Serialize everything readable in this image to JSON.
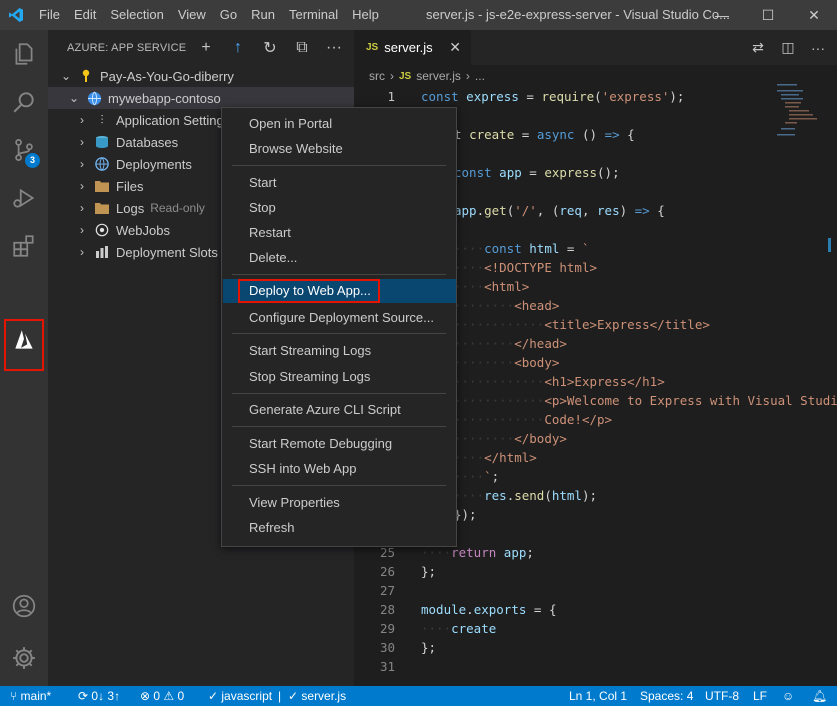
{
  "titlebar": {
    "menu": [
      "File",
      "Edit",
      "Selection",
      "View",
      "Go",
      "Run",
      "Terminal",
      "Help"
    ],
    "title": "server.js - js-e2e-express-server - Visual Studio Co...",
    "controls": {
      "minimize": "—",
      "maximize": "☐",
      "close": "✕"
    }
  },
  "activity_bar": {
    "items": [
      "explorer-icon",
      "search-icon",
      "source-control-icon",
      "run-debug-icon",
      "extensions-icon",
      "azure-icon",
      "account-icon",
      "settings-gear-icon"
    ],
    "scm_badge": "3"
  },
  "sidebar": {
    "title": "AZURE: APP SERVICE",
    "actions": [
      "+",
      "↑",
      "↻",
      "⧉",
      "···"
    ],
    "tree": [
      {
        "label": "Pay-As-You-Go-diberry",
        "icon": "key-icon",
        "desc": ""
      },
      {
        "label": "mywebapp-contoso",
        "icon": "globe-icon",
        "desc": ""
      },
      {
        "label": "Application Settings",
        "icon": "settings-sliders-icon",
        "desc": ""
      },
      {
        "label": "Databases",
        "icon": "database-icon",
        "desc": ""
      },
      {
        "label": "Deployments",
        "icon": "deployments-icon",
        "desc": ""
      },
      {
        "label": "Files",
        "icon": "folder-icon",
        "desc": ""
      },
      {
        "label": "Logs",
        "icon": "folder-icon",
        "desc": "Read-only"
      },
      {
        "label": "WebJobs",
        "icon": "webjobs-icon",
        "desc": ""
      },
      {
        "label": "Deployment Slots",
        "icon": "slots-icon",
        "desc": ""
      }
    ]
  },
  "editor": {
    "tab": {
      "badge": "JS",
      "name": "server.js",
      "close": "✕"
    },
    "breadcrumb": {
      "folder": "src",
      "badge": "JS",
      "file": "server.js",
      "more": "..."
    },
    "colors": {
      "keyword": "#569cd6",
      "variable": "#9cdcfe",
      "function": "#dcdcaa",
      "string": "#ce9178"
    }
  },
  "context_menu": {
    "groups": [
      [
        "Open in Portal",
        "Browse Website"
      ],
      [
        "Start",
        "Stop",
        "Restart",
        "Delete..."
      ],
      [
        "Deploy to Web App..."
      ],
      [
        "Configure Deployment Source..."
      ],
      [
        "Start Streaming Logs",
        "Stop Streaming Logs"
      ],
      [
        "Generate Azure CLI Script"
      ],
      [
        "Start Remote Debugging",
        "SSH into Web App"
      ],
      [
        "View Properties",
        "Refresh"
      ]
    ],
    "focused": "Deploy to Web App..."
  },
  "statusbar": {
    "branch": "main*",
    "sync": "0↓ 3↑",
    "problems": "⊗ 0 ⚠ 0",
    "language_check": "✓ javascript",
    "file": "✓ server.js",
    "position": "Ln 1, Col 1",
    "spaces": "Spaces: 4",
    "encoding": "UTF-8",
    "eol": "LF",
    "accent": "#007acc"
  }
}
